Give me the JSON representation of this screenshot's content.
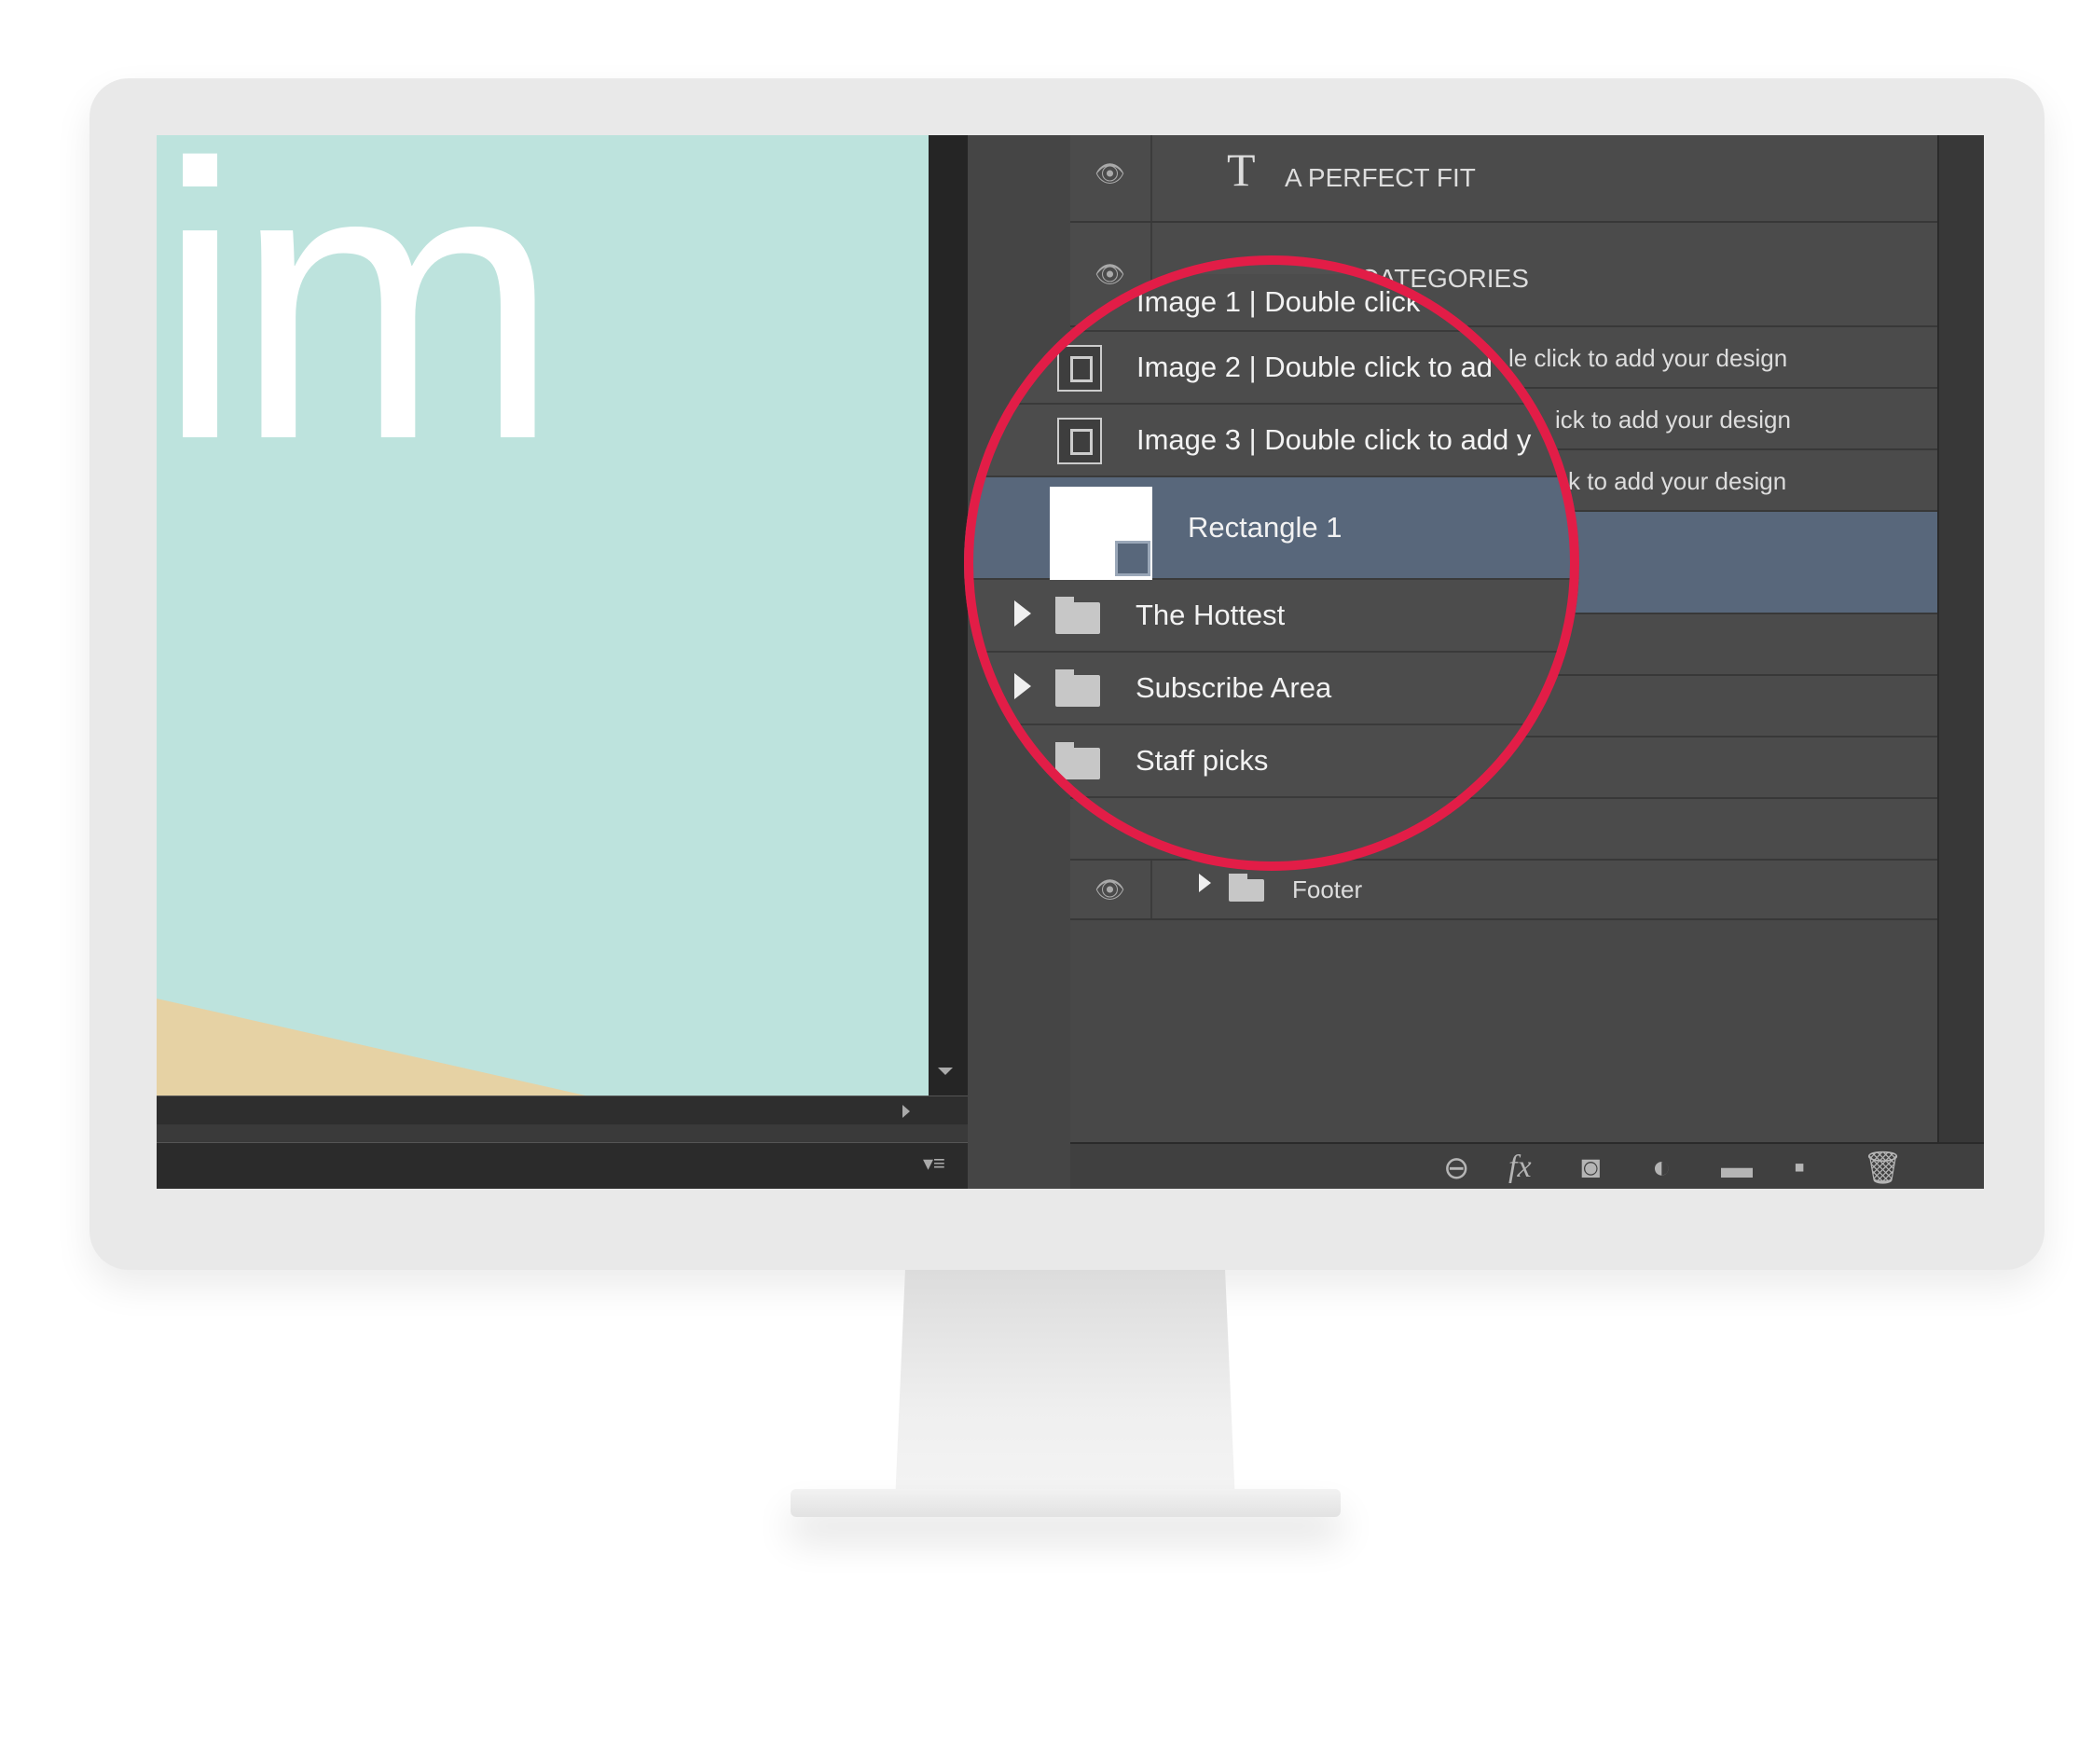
{
  "canvas": {
    "text": "im"
  },
  "layers": {
    "top": [
      {
        "name": "A PERFECT FIT"
      },
      {
        "name": "BEST CATEGORIES"
      }
    ],
    "smart_object_tail": [
      "le click to add your design",
      "ick to add your design",
      "k to add your design"
    ],
    "footer": "Footer"
  },
  "magnifier": {
    "image1": "Image 1 | Double click",
    "image2": "Image 2 | Double click to ad",
    "image3": "Image 3 | Double click to add y",
    "selected": "Rectangle 1",
    "group1": "The Hottest",
    "group2": "Subscribe Area",
    "group3": "Staff picks",
    "ring_color": "#e21d47",
    "selected_color": "#58677b"
  },
  "toolbar": {
    "link": "⊖",
    "fx": "fx",
    "mask": "◙",
    "adjust": "◐",
    "group": "▬",
    "new": "▪",
    "delete": "🗑"
  }
}
